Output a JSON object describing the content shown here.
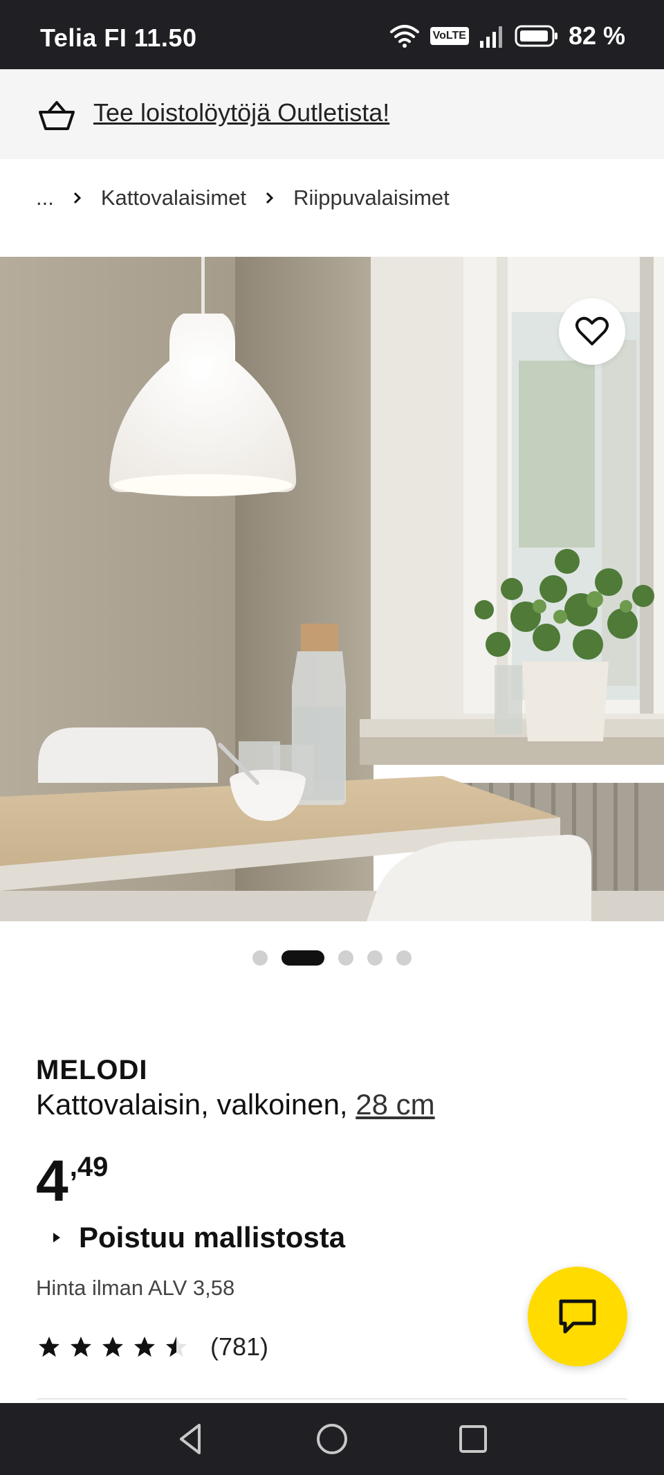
{
  "status_bar": {
    "carrier_time": "Telia FI 11.50",
    "volte": "VoLTE",
    "battery": "82 %"
  },
  "promo": {
    "text": "Tee loistolöytöjä Outletista!",
    "icon": "shopping-basket-icon"
  },
  "breadcrumb": {
    "ellipsis": "...",
    "items": [
      "Kattovalaisimet",
      "Riippuvalaisimet"
    ]
  },
  "gallery": {
    "image_count": 5,
    "active_index": 1
  },
  "product": {
    "name": "MELODI",
    "description": "Kattovalaisin, valkoinen,",
    "size": "28 cm",
    "price_integer": "4",
    "price_decimal": ",49",
    "status": "Poistuu mallistosta",
    "vat_text": "Hinta ilman ALV 3,58",
    "rating": 4.5,
    "review_count": "(781)"
  },
  "colors": {
    "accent_yellow": "#ffdb00",
    "system_bar": "#202024"
  }
}
